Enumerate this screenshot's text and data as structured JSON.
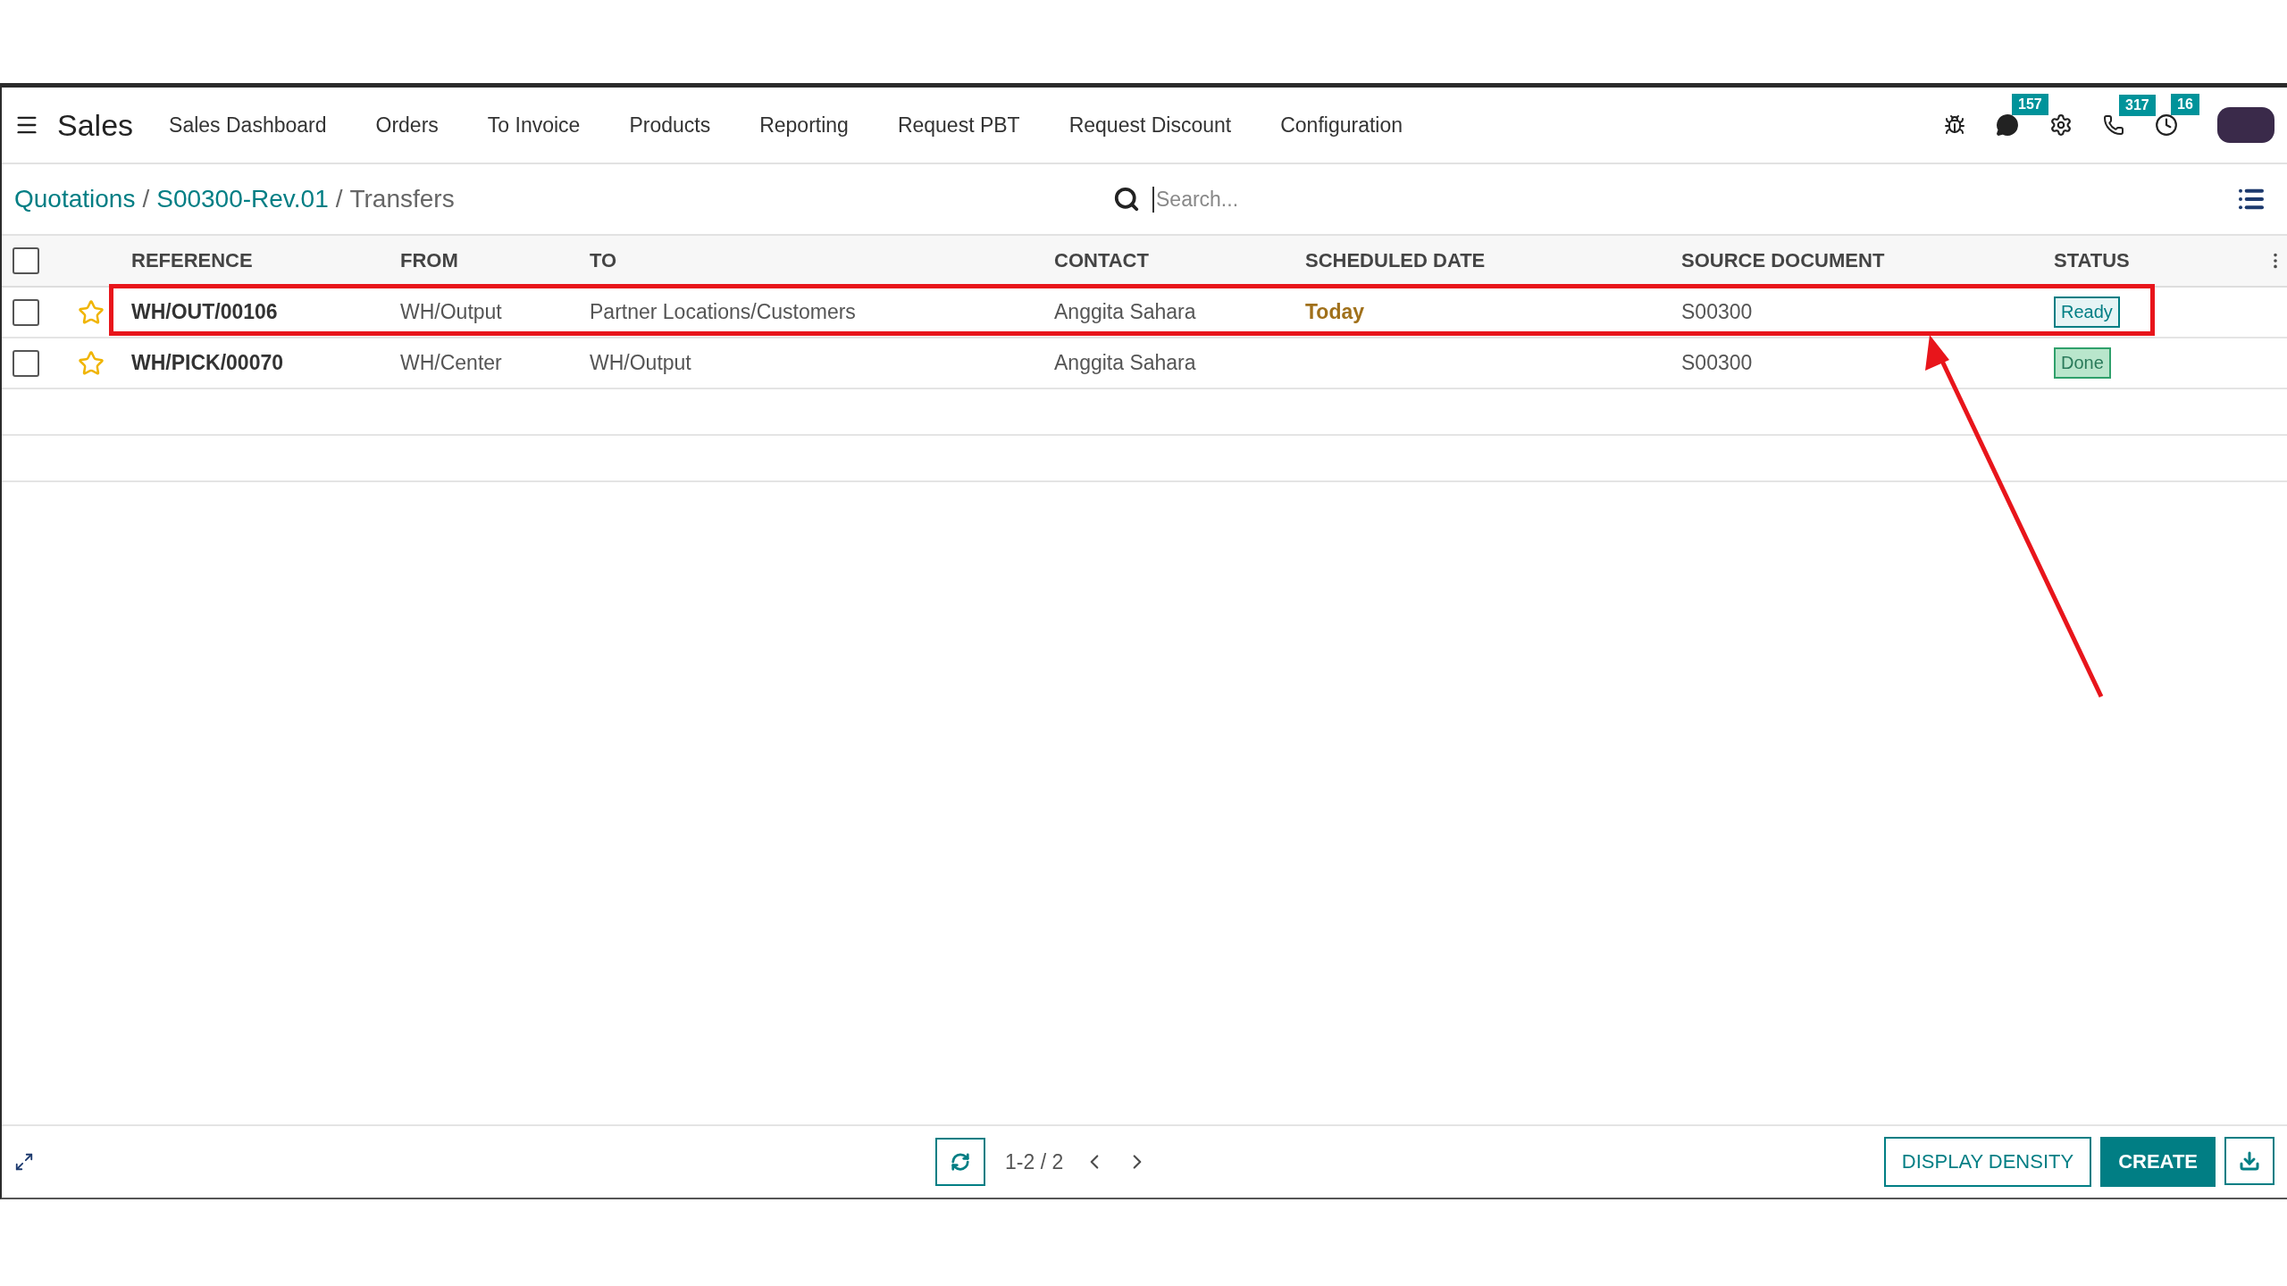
{
  "app_title": "Sales",
  "menu": [
    {
      "label": "Sales Dashboard"
    },
    {
      "label": "Orders"
    },
    {
      "label": "To Invoice"
    },
    {
      "label": "Products"
    },
    {
      "label": "Reporting"
    },
    {
      "label": "Request PBT"
    },
    {
      "label": "Request Discount"
    },
    {
      "label": "Configuration"
    }
  ],
  "systray": [
    {
      "kind": "bug"
    },
    {
      "kind": "chat",
      "badge": "157"
    },
    {
      "kind": "settings"
    },
    {
      "kind": "phone",
      "badge": "317"
    },
    {
      "kind": "clock",
      "badge": "16"
    },
    {
      "kind": "avatar"
    }
  ],
  "breadcrumb": [
    {
      "label": "Quotations",
      "link": true
    },
    {
      "separator": "/",
      "label": "S00300-Rev.01",
      "link": true
    },
    {
      "separator": "/",
      "label": "Transfers",
      "link": false
    }
  ],
  "search": {
    "placeholder": "Search..."
  },
  "table": {
    "columns": [
      "REFERENCE",
      "FROM",
      "TO",
      "CONTACT",
      "SCHEDULED DATE",
      "SOURCE DOCUMENT",
      "STATUS"
    ],
    "select_all": {
      "checked": false
    },
    "rows": [
      {
        "checked": false,
        "favorite": false,
        "highlighted": true,
        "reference": "WH/OUT/00106",
        "from": "WH/Output",
        "to": "Partner Locations/Customers",
        "contact": "Anggita Sahara",
        "scheduled_date": "Today",
        "source_document": "S00300",
        "status": {
          "label": "Ready",
          "kind": "ready"
        }
      },
      {
        "checked": false,
        "favorite": false,
        "highlighted": false,
        "reference": "WH/PICK/00070",
        "from": "WH/Center",
        "to": "WH/Output",
        "contact": "Anggita Sahara",
        "source_document": "S00300",
        "status": {
          "label": "Done",
          "kind": "done"
        }
      }
    ]
  },
  "pager": {
    "range": "1-2 / 2"
  },
  "buttons": [
    {
      "label": "DISPLAY DENSITY",
      "kind": "outline"
    },
    {
      "label": "CREATE",
      "kind": "primary"
    }
  ]
}
